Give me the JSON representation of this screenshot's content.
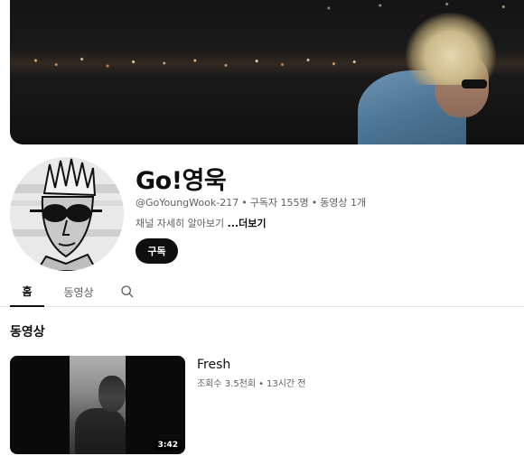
{
  "channel": {
    "name": "Go!영욱",
    "handle": "@GoYoungWook-217",
    "subscribers": "구독자 155명",
    "video_count": "동영상 1개",
    "description": "채널 자세히 알아보기",
    "more_label": "...더보기",
    "subscribe_label": "구독"
  },
  "tabs": {
    "home": "홈",
    "videos": "동영상"
  },
  "section": {
    "title": "동영상"
  },
  "videos": [
    {
      "title": "Fresh",
      "views": "조회수 3.5천회",
      "age": "13시간 전",
      "duration": "3:42"
    }
  ],
  "colors": {
    "text_primary": "#0f0f0f",
    "text_secondary": "#606060",
    "subscribe_bg": "#0f0f0f",
    "divider": "#e5e5e5"
  },
  "icons": {
    "search": "search-icon"
  }
}
